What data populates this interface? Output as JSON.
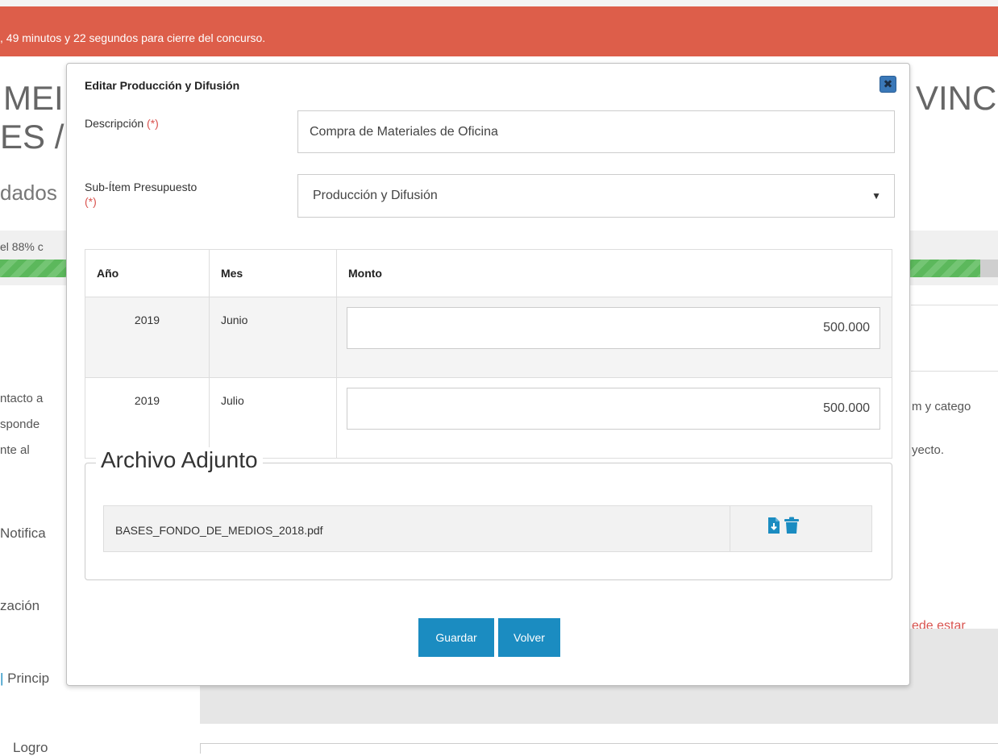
{
  "banner": {
    "text": ", 49 minutos y 22 segundos para cierre del concurso."
  },
  "background": {
    "title_left_1": "MEI",
    "title_left_2": "ES /",
    "title_right": "VINCI",
    "subtitle_left": "dados",
    "progress_label": "el 88% c",
    "progress_percent": 88,
    "text_ntacto": "ntacto a",
    "text_sponde": "sponde",
    "text_nte_al": "nte al",
    "text_right_1": "m y catego",
    "text_right_2": "yecto.",
    "text_notifica": "Notifica",
    "text_zacion": "zación",
    "text_red": "ede estar",
    "text_princip": "Princip",
    "text_logro": "Logro"
  },
  "modal": {
    "title": "Editar Producción y Difusión",
    "close_symbol": "✖",
    "descripcion_label": "Descripción",
    "required_mark": "(*)",
    "descripcion_value": "Compra de Materiales de Oficina",
    "subitem_label": "Sub-Ítem Presupuesto",
    "subitem_value": "Producción y Difusión",
    "table": {
      "headers": [
        "Año",
        "Mes",
        "Monto"
      ],
      "rows": [
        {
          "ano": "2019",
          "mes": "Junio",
          "monto": "500.000"
        },
        {
          "ano": "2019",
          "mes": "Julio",
          "monto": "500.000"
        }
      ]
    },
    "attachment": {
      "legend": "Archivo Adjunto",
      "file_name": "BASES_FONDO_DE_MEDIOS_2018.pdf"
    },
    "buttons": {
      "save": "Guardar",
      "back": "Volver"
    },
    "colors": {
      "accent": "#1b8cc1",
      "banner": "#dd5e4a",
      "required": "#d9534f"
    }
  }
}
